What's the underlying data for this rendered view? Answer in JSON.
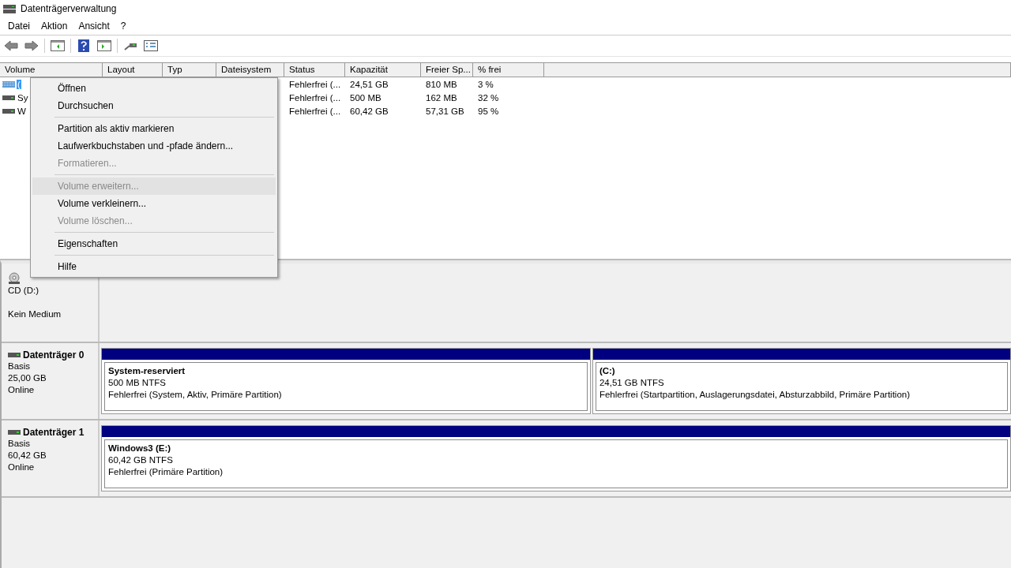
{
  "window": {
    "title": "Datenträgerverwaltung"
  },
  "menu": [
    "Datei",
    "Aktion",
    "Ansicht",
    "?"
  ],
  "volume_list": {
    "columns": [
      "Volume",
      "Layout",
      "Typ",
      "Dateisystem",
      "Status",
      "Kapazität",
      "Freier Sp...",
      "% frei"
    ],
    "rows": [
      {
        "volume": "(",
        "selected": true,
        "status": "Fehlerfrei (...",
        "capacity": "24,51 GB",
        "free": "810 MB",
        "percent_free": "3 %"
      },
      {
        "volume": "Sy",
        "selected": false,
        "status": "Fehlerfrei (...",
        "capacity": "500 MB",
        "free": "162 MB",
        "percent_free": "32 %"
      },
      {
        "volume": "W",
        "selected": false,
        "status": "Fehlerfrei (...",
        "capacity": "60,42 GB",
        "free": "57,31 GB",
        "percent_free": "95 %"
      }
    ]
  },
  "context_menu": [
    {
      "kind": "item",
      "label": "Öffnen",
      "disabled": false,
      "selected": false
    },
    {
      "kind": "item",
      "label": "Durchsuchen",
      "disabled": false,
      "selected": false
    },
    {
      "kind": "separator"
    },
    {
      "kind": "item",
      "label": "Partition als aktiv markieren",
      "disabled": false,
      "selected": false
    },
    {
      "kind": "item",
      "label": "Laufwerkbuchstaben und -pfade ändern...",
      "disabled": false,
      "selected": false
    },
    {
      "kind": "item",
      "label": "Formatieren...",
      "disabled": true,
      "selected": false
    },
    {
      "kind": "separator"
    },
    {
      "kind": "item",
      "label": "Volume erweitern...",
      "disabled": true,
      "selected": true
    },
    {
      "kind": "item",
      "label": "Volume verkleinern...",
      "disabled": false,
      "selected": false
    },
    {
      "kind": "item",
      "label": "Volume löschen...",
      "disabled": true,
      "selected": false
    },
    {
      "kind": "separator"
    },
    {
      "kind": "item",
      "label": "Eigenschaften",
      "disabled": false,
      "selected": false
    },
    {
      "kind": "separator"
    },
    {
      "kind": "item",
      "label": "Hilfe",
      "disabled": false,
      "selected": false
    }
  ],
  "disks": [
    {
      "kind": "cd",
      "lines": [
        "CD (D:)",
        "Kein Medium"
      ]
    },
    {
      "kind": "disk",
      "name": "Datenträger 0",
      "lines": [
        "Basis",
        "25,00 GB",
        "Online"
      ],
      "partitions": [
        {
          "name": "System-reserviert",
          "size": "500 MB NTFS",
          "status": "Fehlerfrei (System, Aktiv, Primäre Partition)"
        },
        {
          "name": "(C:)",
          "size": "24,51 GB NTFS",
          "status": "Fehlerfrei (Startpartition, Auslagerungsdatei, Absturzabbild, Primäre Partition)"
        }
      ]
    },
    {
      "kind": "disk",
      "name": "Datenträger 1",
      "lines": [
        "Basis",
        "60,42 GB",
        "Online"
      ],
      "partitions": [
        {
          "name": "Windows3  (E:)",
          "size": "60,42 GB NTFS",
          "status": "Fehlerfrei (Primäre Partition)"
        }
      ]
    }
  ]
}
